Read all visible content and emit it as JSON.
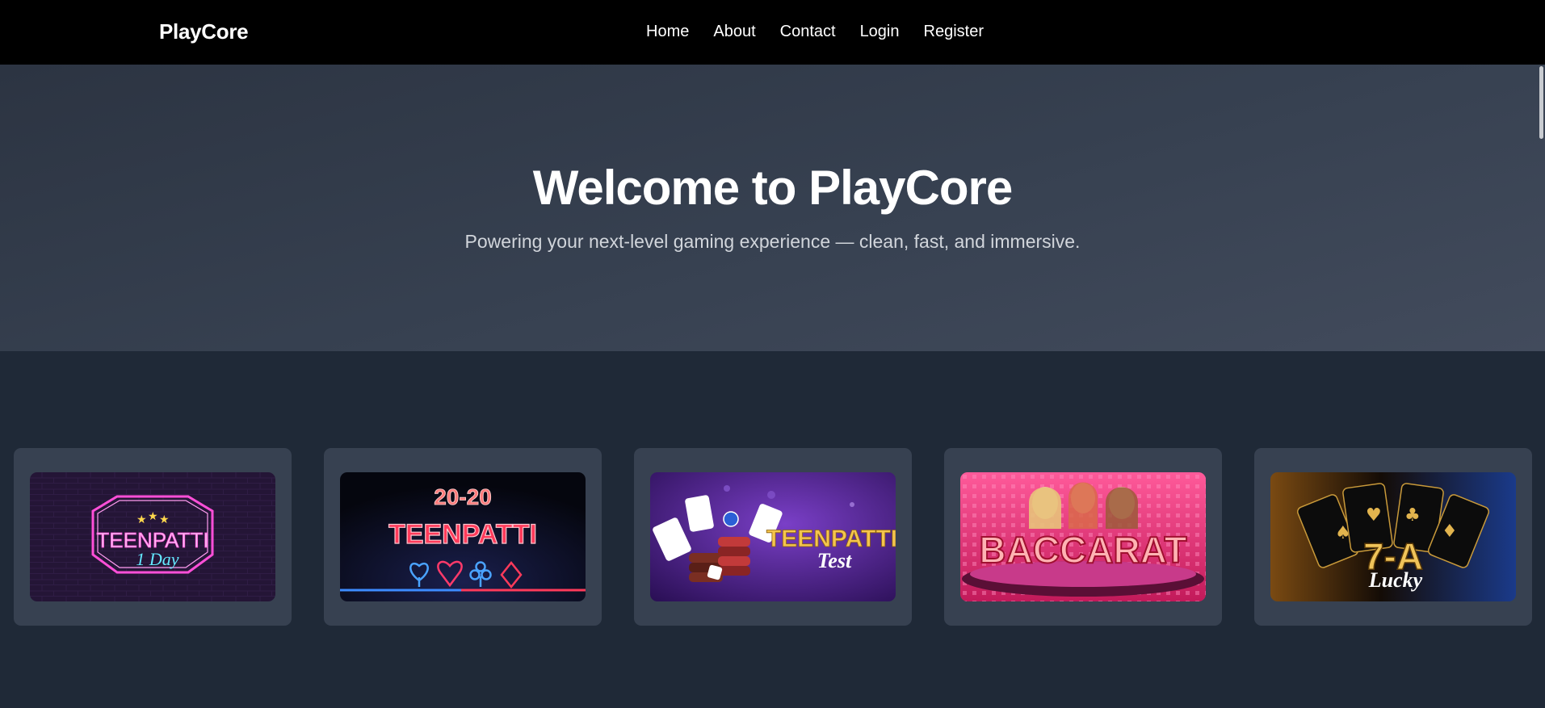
{
  "nav": {
    "brand": "PlayCore",
    "links": [
      "Home",
      "About",
      "Contact",
      "Login",
      "Register"
    ]
  },
  "hero": {
    "title": "Welcome to PlayCore",
    "subtitle": "Powering your next-level gaming experience — clean, fast, and immersive."
  },
  "games": [
    {
      "line1": "TEENPATTI",
      "line2": "1 Day",
      "icon": "neon-hexagon-sign-icon"
    },
    {
      "line1": "20-20",
      "line2": "TEENPATTI",
      "icon": "card-suits-icon"
    },
    {
      "line1": "TEENPATTI",
      "line2": "Test",
      "icon": "chips-and-cards-icon"
    },
    {
      "line1": "BACCARAT",
      "icon": "baccarat-table-icon"
    },
    {
      "line1": "7-A",
      "line2": "Lucky",
      "icon": "fanned-cards-icon"
    }
  ],
  "colors": {
    "navbar": "#000000",
    "hero": "#374151",
    "page": "#1f2937",
    "card": "#374151"
  }
}
